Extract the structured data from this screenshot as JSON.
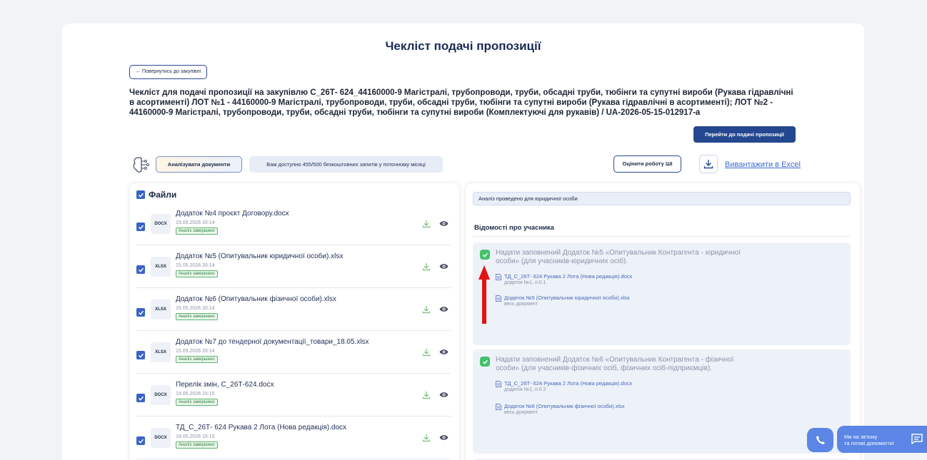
{
  "page_title": "Чекліст подачі пропозиції",
  "back_button": "← Повернутись до закупівлі",
  "description": "Чекліст для подачі пропозиції на закупівлю С_26Т- 624_44160000-9 Магістралі, трубопроводи, труби, обсадні труби, тюбінги та супутні вироби (Рукава гідравлічні в асортименті) ЛОТ №1 - 44160000-9 Магістралі, трубопроводи, труби, обсадні труби, тюбінги та супутні вироби (Рукава гідравлічні в асортименті); ЛОТ №2 - 44160000-9 Магістралі, трубопроводи, труби, обсадні труби, тюбінги та супутні вироби (Комплектуючі для рукавів) / UA-2026-05-15-012917-a",
  "submit_button": "Перейти до подачі пропозиції",
  "analyze_button": "Аналізувати документи",
  "quota_text": "Вам доступно 455/500 безкоштовних запитів у поточному місяці",
  "rate_button": "Оцінити роботу ШІ",
  "excel_link": "Вивантажити в Excel",
  "files": {
    "header": "Файли",
    "items": [
      {
        "ext": "DOCX",
        "name": "Додаток №4 проєкт Договору.docx",
        "date": "15.05.2026 20:14",
        "status": "Аналіз завершено"
      },
      {
        "ext": "XLSX",
        "name": "Додаток №5 (Опитувальник юридичної особи).xlsx",
        "date": "15.05.2026 20:14",
        "status": "Аналіз завершено"
      },
      {
        "ext": "XLSX",
        "name": "Додаток №6 (Опитувальник фізичної особи).xlsx",
        "date": "15.05.2026 20:14",
        "status": "Аналіз завершено"
      },
      {
        "ext": "XLSX",
        "name": "Додаток №7 до тендерної документації_товари_18.05.xlsx",
        "date": "15.05.2026 20:14",
        "status": "Аналіз завершено"
      },
      {
        "ext": "DOCX",
        "name": "Перелік змін, С_26Т-624.docx",
        "date": "19.05.2026 15:15",
        "status": "Аналіз завершено"
      },
      {
        "ext": "DOCX",
        "name": "ТД_С_26Т- 624 Рукава 2 Лота (Нова редакція).docx",
        "date": "19.05.2026 15:15",
        "status": "Аналіз завершено"
      }
    ]
  },
  "analysis": {
    "entity_bar": "Аналіз проведено для юридичної особи",
    "section_title": "Відомості про учасника",
    "requirements": [
      {
        "text": "Надати заповнений Додаток №5 «Опитувальник Контрагента - юридичної особи» (для учасників-юридичних осіб).",
        "sources": [
          {
            "name": "ТД_С_26Т- 624 Рукава 2 Лота (Нова редакція).docx",
            "ref": "додаток №1, п.ІІ.1"
          },
          {
            "name": "Додаток №5 (Опитувальник юридичної особи).xlsx",
            "ref": "весь документ"
          }
        ]
      },
      {
        "text": "Надати заповнений Додаток №6 «Опитувальник Контрагента - фізичної особи» (для учасників-фізичних осіб, фізичних осіб-підприємців).",
        "sources": [
          {
            "name": "ТД_С_26Т- 624 Рукава 2 Лота (Нова редакція).docx",
            "ref": "додаток №1, п.ІІ.2"
          },
          {
            "name": "Додаток №6 (Опитувальник фізичної особи).xlsx",
            "ref": "весь документ"
          }
        ]
      }
    ]
  },
  "help_widget": {
    "line1": "Ми на зв'язку",
    "line2": "та готові допомогти!"
  },
  "colors": {
    "primary": "#24478f",
    "accent": "#3a63c7",
    "success": "#45c06a",
    "arrow": "#e01414"
  }
}
